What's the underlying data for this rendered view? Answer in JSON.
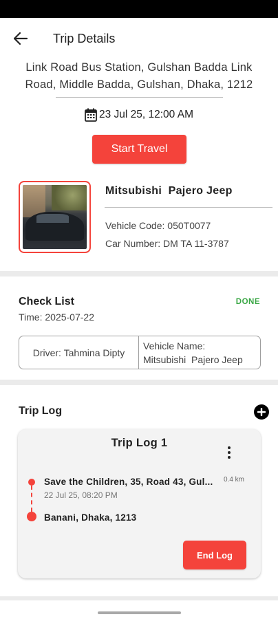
{
  "header": {
    "title": "Trip Details"
  },
  "trip": {
    "address_line1": "Link Road Bus Station, Gulshan Badda Link",
    "address_line2": "Road, Middle Badda, Gulshan, Dhaka, 1212",
    "date": "23 Jul 25, 12:00 AM",
    "start_label": "Start Travel"
  },
  "vehicle": {
    "name": "Mitsubishi  Pajero Jeep",
    "code": "Vehicle Code: 050T0077",
    "number": "Car Number: DM TA 11-3787"
  },
  "checklist": {
    "title": "Check List",
    "status": "DONE",
    "time": "Time: 2025-07-22",
    "driver": "Driver: Tahmina Dipty",
    "vehicle_label": "Vehicle Name:",
    "vehicle_name": "Mitsubishi  Pajero Jeep"
  },
  "trip_log": {
    "title": "Trip Log",
    "card_title": "Trip Log 1",
    "from": "Save the Children, 35, Road 43, Gul...",
    "distance": "0.4 km",
    "from_time": "22 Jul 25, 08:20 PM",
    "to": "Banani, Dhaka, 1213",
    "end_label": "End Log"
  },
  "colors": {
    "accent": "#f4433b",
    "done": "#3aa745"
  },
  "icons": {
    "back": "arrow-left-icon",
    "calendar": "calendar-icon",
    "add": "plus-circle-icon",
    "menu": "more-vert-icon"
  }
}
